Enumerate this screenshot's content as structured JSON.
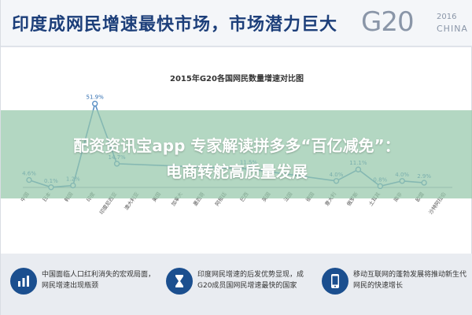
{
  "header": {
    "title": "印度成网民增速最快市场，市场潜力巨大",
    "logo_text": "G20",
    "logo_year": "2016",
    "logo_country": "CHINA"
  },
  "banner": {
    "line1": "配资资讯宝app 专家解读拼多多“百亿减免”：",
    "line2": "电商转舵高质量发展"
  },
  "chart_data": {
    "type": "line",
    "title": "2015年G20各国网民数量增速对比图",
    "categories": [
      "中国",
      "日本",
      "韩国",
      "印度",
      "印度尼西亚",
      "澳大利亚",
      "美国",
      "加拿大",
      "墨西哥",
      "阿根廷",
      "巴西",
      "英国",
      "法国",
      "德国",
      "意大利",
      "俄罗斯",
      "土耳其",
      "南非",
      "欧盟",
      "沙特阿拉伯"
    ],
    "values": [
      4.6,
      0.1,
      1.2,
      51.9,
      14.7,
      null,
      null,
      null,
      null,
      null,
      11.5,
      null,
      null,
      null,
      4.0,
      11.1,
      0.8,
      4.0,
      2.9,
      null
    ],
    "data_labels": [
      "4.6%",
      "0.1%",
      "1.2%",
      "51.9%",
      "14.7%",
      "",
      "",
      "",
      "",
      "",
      "11.5%",
      "",
      "",
      "",
      "4.0%",
      "11.1%",
      "0.8%",
      "4.0%",
      "2.9%",
      ""
    ],
    "ylim": [
      0,
      60
    ],
    "grid": false,
    "colors": {
      "line": "#5a8fc4",
      "marker": "#5a8fc4"
    }
  },
  "footer": {
    "panels": [
      {
        "icon": "chart-icon",
        "text": "中国面临人口红利消失的宏观局面，网民增速出现瓶颈"
      },
      {
        "icon": "hourglass-icon",
        "text": "印度网民增速的后发优势显现，成G20成员国网民增速最快的国家"
      },
      {
        "icon": "phone-icon",
        "text": "移动互联网的蓬勃发展将推动新生代网民的快速增长"
      }
    ]
  },
  "colors": {
    "title": "#1d3f7a",
    "banner": "#96c8aa",
    "icon_bg": "#1b4f8f",
    "footer_bg": "#e9ecf1"
  }
}
